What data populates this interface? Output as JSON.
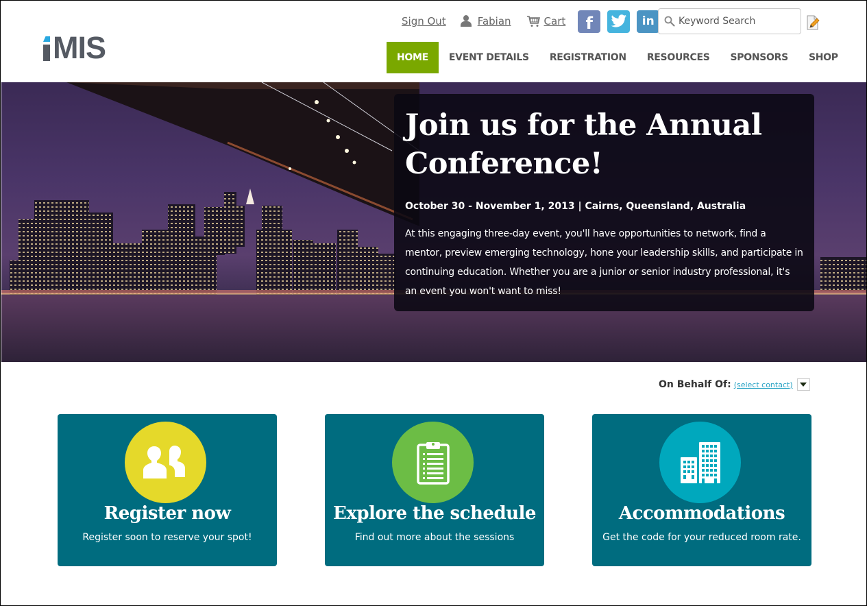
{
  "brand": {
    "logo_text": "MIS",
    "logo_full": "iMIS",
    "accent": "#29a8e0",
    "logo_color": "#555a63"
  },
  "utility": {
    "sign_out": "Sign Out",
    "user_name": "Fabian",
    "cart": "Cart",
    "social": [
      {
        "name": "facebook",
        "glyph": "f",
        "color": "#7186b8"
      },
      {
        "name": "twitter",
        "glyph": "",
        "color": "#45b4de"
      },
      {
        "name": "linkedin",
        "glyph": "in",
        "color": "#4b94c3"
      }
    ]
  },
  "search": {
    "placeholder": "Keyword Search",
    "value": ""
  },
  "nav": {
    "active_color": "#7aa800",
    "items": [
      {
        "label": "HOME",
        "active": true
      },
      {
        "label": "EVENT DETAILS",
        "active": false
      },
      {
        "label": "REGISTRATION",
        "active": false
      },
      {
        "label": "RESOURCES",
        "active": false
      },
      {
        "label": "SPONSORS",
        "active": false
      },
      {
        "label": "SHOP",
        "active": false
      }
    ]
  },
  "hero": {
    "title_line1": "Join us for the Annual",
    "title_line2": "Conference!",
    "meta": "October 30 - November 1, 2013 | Cairns, Queensland, Australia",
    "description": "At this engaging three-day event, you'll have opportunities to network, find a mentor, preview emerging technology, hone your leadership skills, and participate in continuing education. Whether you are a junior or senior industry professional, it's an event you won't want to miss!"
  },
  "on_behalf": {
    "label": "On Behalf Of:",
    "link": "(select contact)"
  },
  "cards": [
    {
      "title": "Register now",
      "subtitle": "Register soon to reserve your spot!",
      "icon": "users-icon",
      "circle_color": "#e5d92a"
    },
    {
      "title": "Explore the schedule",
      "subtitle": "Find out more about the sessions",
      "icon": "clipboard-icon",
      "circle_color": "#6cbd45"
    },
    {
      "title": "Accommodations",
      "subtitle": "Get the code for your reduced room rate.",
      "icon": "buildings-icon",
      "circle_color": "#00a8bd"
    }
  ],
  "card_color": "#006c7f"
}
